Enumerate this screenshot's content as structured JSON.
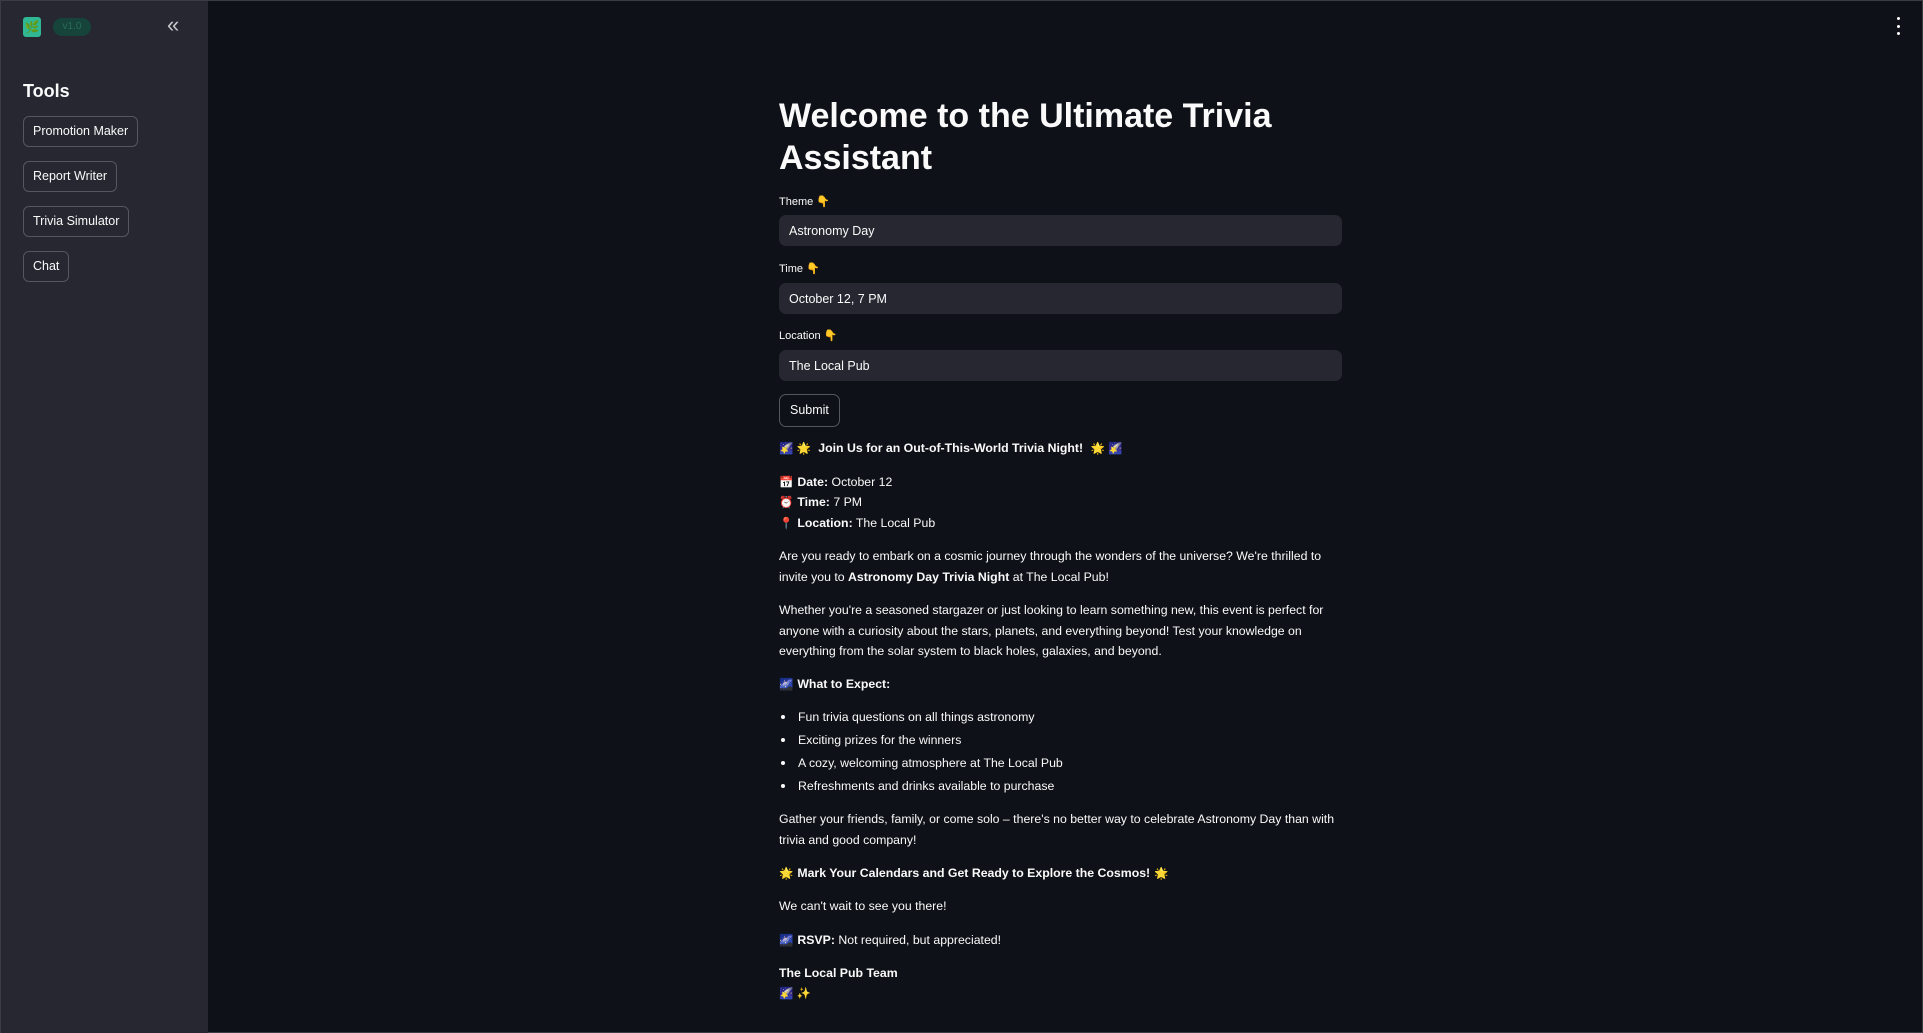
{
  "sidebar": {
    "logo_glyph": "🌿",
    "logo_pill_text": "v1.0",
    "collapse_glyph": "«",
    "title": "Tools",
    "buttons": [
      {
        "label": "Promotion Maker"
      },
      {
        "label": "Report Writer"
      },
      {
        "label": "Trivia Simulator"
      },
      {
        "label": "Chat"
      }
    ]
  },
  "main": {
    "title": "Welcome to the Ultimate Trivia Assistant",
    "fields": [
      {
        "label": "Theme 👇",
        "value": "Astronomy Day"
      },
      {
        "label": "Time 👇",
        "value": "October 12, 7 PM"
      },
      {
        "label": "Location 👇",
        "value": "The Local Pub"
      }
    ],
    "submit_label": "Submit"
  },
  "output": {
    "headline_emoji_left": "🌠 🌟",
    "headline": "Join Us for an Out-of-This-World Trivia Night!",
    "headline_emoji_right": "🌟 🌠",
    "date_emoji": "📅",
    "date_label": "Date:",
    "date_value": "October 12",
    "time_emoji": "⏰",
    "time_label": "Time:",
    "time_value": "7 PM",
    "location_emoji": "📍",
    "location_label": "Location:",
    "location_value": "The Local Pub",
    "para1_a": "Are you ready to embark on a cosmic journey through the wonders of the universe? We're thrilled to invite you to",
    "para1_bold": "Astronomy Day Trivia Night",
    "para1_b": "at The Local Pub!",
    "para2": "Whether you're a seasoned stargazer or just looking to learn something new, this event is perfect for anyone with a curiosity about the stars, planets, and everything beyond! Test your knowledge on everything from the solar system to black holes, galaxies, and beyond.",
    "expect_emoji": "🌌",
    "expect_heading": "What to Expect:",
    "expect_items": [
      "Fun trivia questions on all things astronomy",
      "Exciting prizes for the winners",
      "A cozy, welcoming atmosphere at The Local Pub",
      "Refreshments and drinks available to purchase"
    ],
    "para3": "Gather your friends, family, or come solo – there's no better way to celebrate Astronomy Day than with trivia and good company!",
    "cta_emoji_left": "🌟",
    "cta": "Mark Your Calendars and Get Ready to Explore the Cosmos!",
    "cta_emoji_right": "🌟",
    "closing": "We can't wait to see you there!",
    "rsvp_emoji": "🌌",
    "rsvp_label": "RSVP:",
    "rsvp_value": "Not required, but appreciated!",
    "signature": "The Local Pub Team",
    "signature_emoji": "🌠 ✨"
  }
}
